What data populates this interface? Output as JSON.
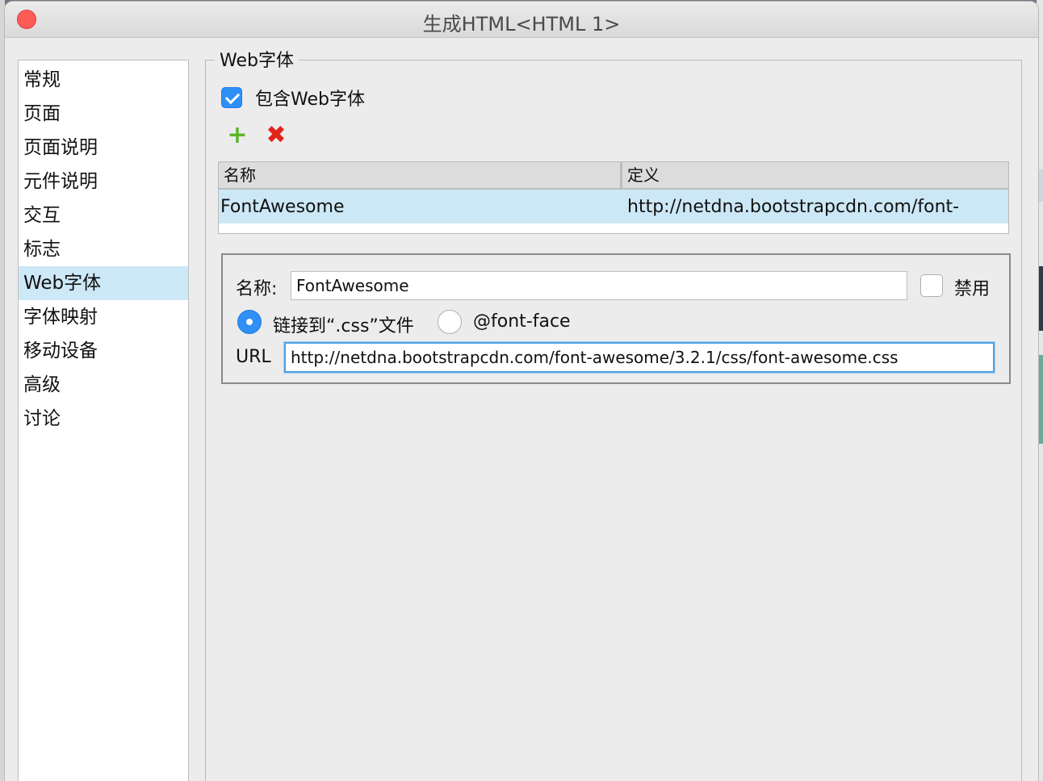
{
  "window": {
    "title": "生成HTML<HTML 1>"
  },
  "sidebar": {
    "items": [
      {
        "label": "常规"
      },
      {
        "label": "页面"
      },
      {
        "label": "页面说明"
      },
      {
        "label": "元件说明"
      },
      {
        "label": "交互"
      },
      {
        "label": "标志"
      },
      {
        "label": "Web字体",
        "selected": true
      },
      {
        "label": "字体映射"
      },
      {
        "label": "移动设备"
      },
      {
        "label": "高级"
      },
      {
        "label": "讨论"
      }
    ]
  },
  "panel": {
    "group_title": "Web字体",
    "include_checkbox": {
      "label": "包含Web字体",
      "checked": true
    },
    "add_icon": "plus-icon",
    "delete_icon": "x-icon",
    "table": {
      "columns": [
        "名称",
        "定义"
      ],
      "rows": [
        {
          "name": "FontAwesome",
          "definition": "http://netdna.bootstrapcdn.com/font-"
        }
      ]
    },
    "detail": {
      "name_label": "名称:",
      "name_value": "FontAwesome",
      "disable_label": "禁用",
      "disable_checked": false,
      "radio_link_label": "链接到“.css”文件",
      "radio_link_selected": true,
      "radio_fontface_label": "@font-face",
      "url_label": "URL",
      "url_value": "http://netdna.bootstrapcdn.com/font-awesome/3.2.1/css/font-awesome.css"
    }
  },
  "colors": {
    "accent": "#2e8ff5",
    "selection": "#cde8f6",
    "add_green": "#5bb52a",
    "delete_red": "#e2231a",
    "close_red": "#fc5b57"
  }
}
